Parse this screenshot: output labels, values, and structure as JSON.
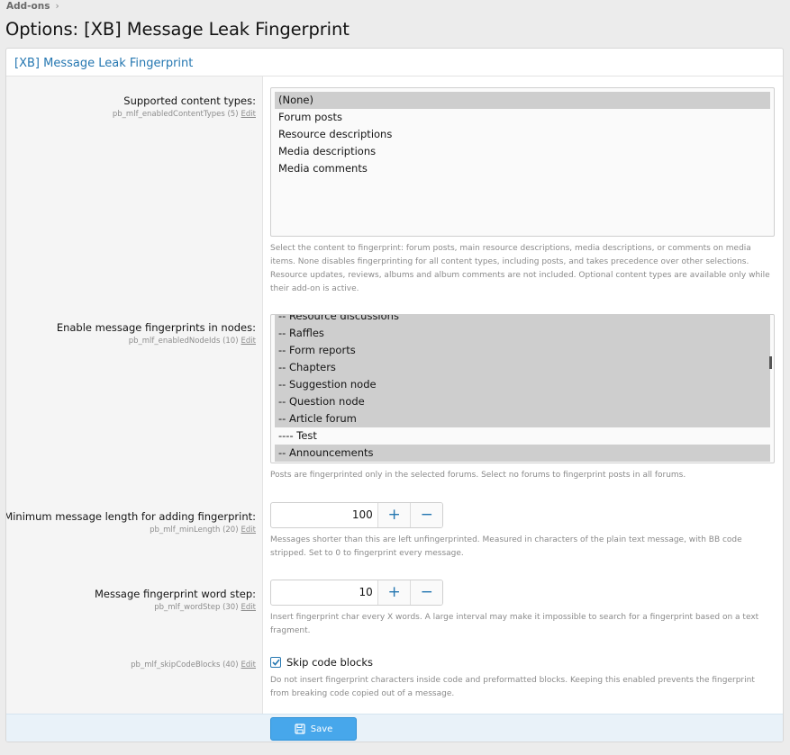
{
  "breadcrumb": {
    "item": "Add-ons",
    "separator": "›"
  },
  "page_title": "Options: [XB] Message Leak Fingerprint",
  "block_title": "[XB] Message Leak Fingerprint",
  "options": {
    "content_types": {
      "label": "Supported content types:",
      "hint": "pb_mlf_enabledContentTypes (5)",
      "edit": "Edit",
      "items": [
        {
          "label": "(None)",
          "selected": true
        },
        {
          "label": "Forum posts",
          "selected": false
        },
        {
          "label": "Resource descriptions",
          "selected": false
        },
        {
          "label": "Media descriptions",
          "selected": false
        },
        {
          "label": "Media comments",
          "selected": false
        }
      ],
      "explain": "Select the content to fingerprint: forum posts, main resource descriptions, media descriptions, or comments on media items. None disables fingerprinting for all content types, including posts, and takes precedence over other selections. Resource updates, reviews, albums and album comments are not included. Optional content types are available only while their add-on is active."
    },
    "nodes": {
      "label": "Enable message fingerprints in nodes:",
      "hint": "pb_mlf_enabledNodeIds (10)",
      "edit": "Edit",
      "items": [
        {
          "label": "-- Resource discussions",
          "selected": true
        },
        {
          "label": "-- Raffles",
          "selected": true
        },
        {
          "label": "-- Form reports",
          "selected": true
        },
        {
          "label": "-- Chapters",
          "selected": true
        },
        {
          "label": "-- Suggestion node",
          "selected": true
        },
        {
          "label": "-- Question node",
          "selected": true
        },
        {
          "label": "-- Article forum",
          "selected": true
        },
        {
          "label": "---- Test",
          "selected": false
        },
        {
          "label": "-- Announcements",
          "selected": true
        }
      ],
      "explain": "Posts are fingerprinted only in the selected forums. Select no forums to fingerprint posts in all forums."
    },
    "min_length": {
      "label": "Minimum message length for adding fingerprint:",
      "hint": "pb_mlf_minLength (20)",
      "edit": "Edit",
      "value": "100",
      "plus": "+",
      "minus": "−",
      "explain": "Messages shorter than this are left unfingerprinted. Measured in characters of the plain text message, with BB code stripped. Set to 0 to fingerprint every message."
    },
    "word_step": {
      "label": "Message fingerprint word step:",
      "hint": "pb_mlf_wordStep (30)",
      "edit": "Edit",
      "value": "10",
      "plus": "+",
      "minus": "−",
      "explain": "Insert fingerprint char every X words. A large interval may make it impossible to search for a fingerprint based on a text fragment."
    },
    "skip_code": {
      "hint": "pb_mlf_skipCodeBlocks (40)",
      "edit": "Edit",
      "checkbox_label": "Skip code blocks",
      "checked": true,
      "explain": "Do not insert fingerprint characters inside code and preformatted blocks. Keeping this enabled prevents the fingerprint from breaking code copied out of a message."
    }
  },
  "footer": {
    "save_label": "Save"
  },
  "colors": {
    "accent": "#2577b1",
    "button": "#47a7eb",
    "selected_option": "#cecece",
    "footer_bg": "#e9f2f9"
  },
  "icons": {
    "save": "save-icon",
    "checkbox": "check-icon"
  }
}
